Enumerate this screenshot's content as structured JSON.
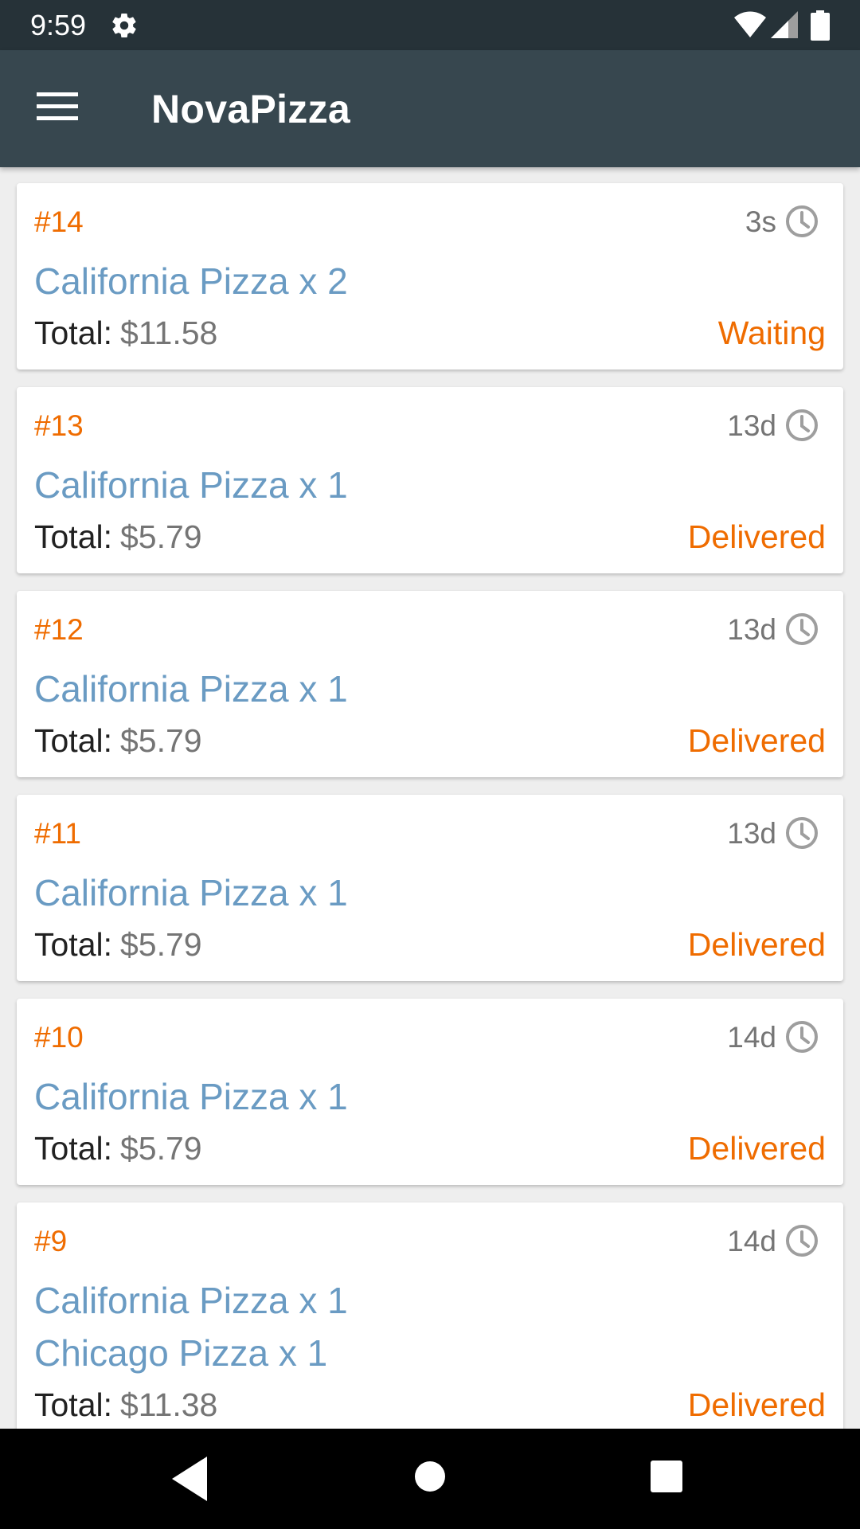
{
  "status_bar": {
    "time": "9:59",
    "icons": [
      "gear-icon",
      "wifi-icon",
      "cell-signal-icon",
      "battery-icon"
    ]
  },
  "app_bar": {
    "title": "NovaPizza",
    "menu_icon": "hamburger-menu-icon"
  },
  "colors": {
    "status_bar_bg": "#263238",
    "app_bar_bg": "#37474f",
    "order_number": "#ef6c00",
    "item_text": "#6a9bc3",
    "status_text": "#ef6c00",
    "secondary_text": "#757575",
    "primary_text": "#212121"
  },
  "orders": [
    {
      "number": "#14",
      "age": "3s",
      "items": [
        "California Pizza x 2"
      ],
      "total_label": "Total:",
      "total": "$11.58",
      "status": "Waiting"
    },
    {
      "number": "#13",
      "age": "13d",
      "items": [
        "California Pizza x 1"
      ],
      "total_label": "Total:",
      "total": "$5.79",
      "status": "Delivered"
    },
    {
      "number": "#12",
      "age": "13d",
      "items": [
        "California Pizza x 1"
      ],
      "total_label": "Total:",
      "total": "$5.79",
      "status": "Delivered"
    },
    {
      "number": "#11",
      "age": "13d",
      "items": [
        "California Pizza x 1"
      ],
      "total_label": "Total:",
      "total": "$5.79",
      "status": "Delivered"
    },
    {
      "number": "#10",
      "age": "14d",
      "items": [
        "California Pizza x 1"
      ],
      "total_label": "Total:",
      "total": "$5.79",
      "status": "Delivered"
    },
    {
      "number": "#9",
      "age": "14d",
      "items": [
        "California Pizza x 1",
        "Chicago Pizza x 1"
      ],
      "total_label": "Total:",
      "total": "$11.38",
      "status": "Delivered"
    }
  ],
  "nav_bar": {
    "icons": [
      "back-icon",
      "home-icon",
      "recents-icon"
    ]
  }
}
